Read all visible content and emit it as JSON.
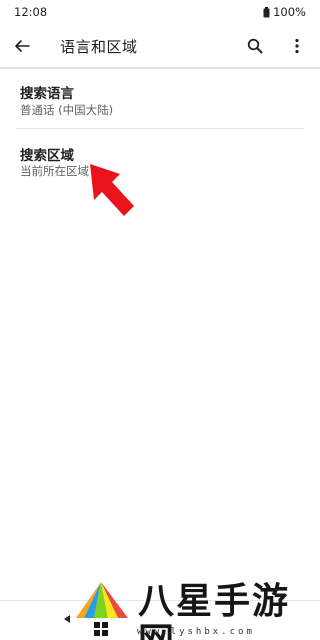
{
  "status_bar": {
    "time": "12:08",
    "battery": "100%"
  },
  "app_bar": {
    "title": "语言和区域",
    "back_icon": "arrow-back-icon",
    "search_icon": "search-icon",
    "more_icon": "more-vert-icon"
  },
  "settings": {
    "items": [
      {
        "title": "搜索语言",
        "subtitle": "普通话 (中国大陆)"
      },
      {
        "title": "搜索区域",
        "subtitle": "当前所在区域"
      }
    ]
  },
  "watermark": {
    "brand": "八星手游网",
    "url": "www.lyshbx.com"
  },
  "colors": {
    "accent_arrow": "#e8131b",
    "text_primary": "#202124",
    "text_secondary": "#5f6368",
    "divider": "#e3e3e3"
  }
}
